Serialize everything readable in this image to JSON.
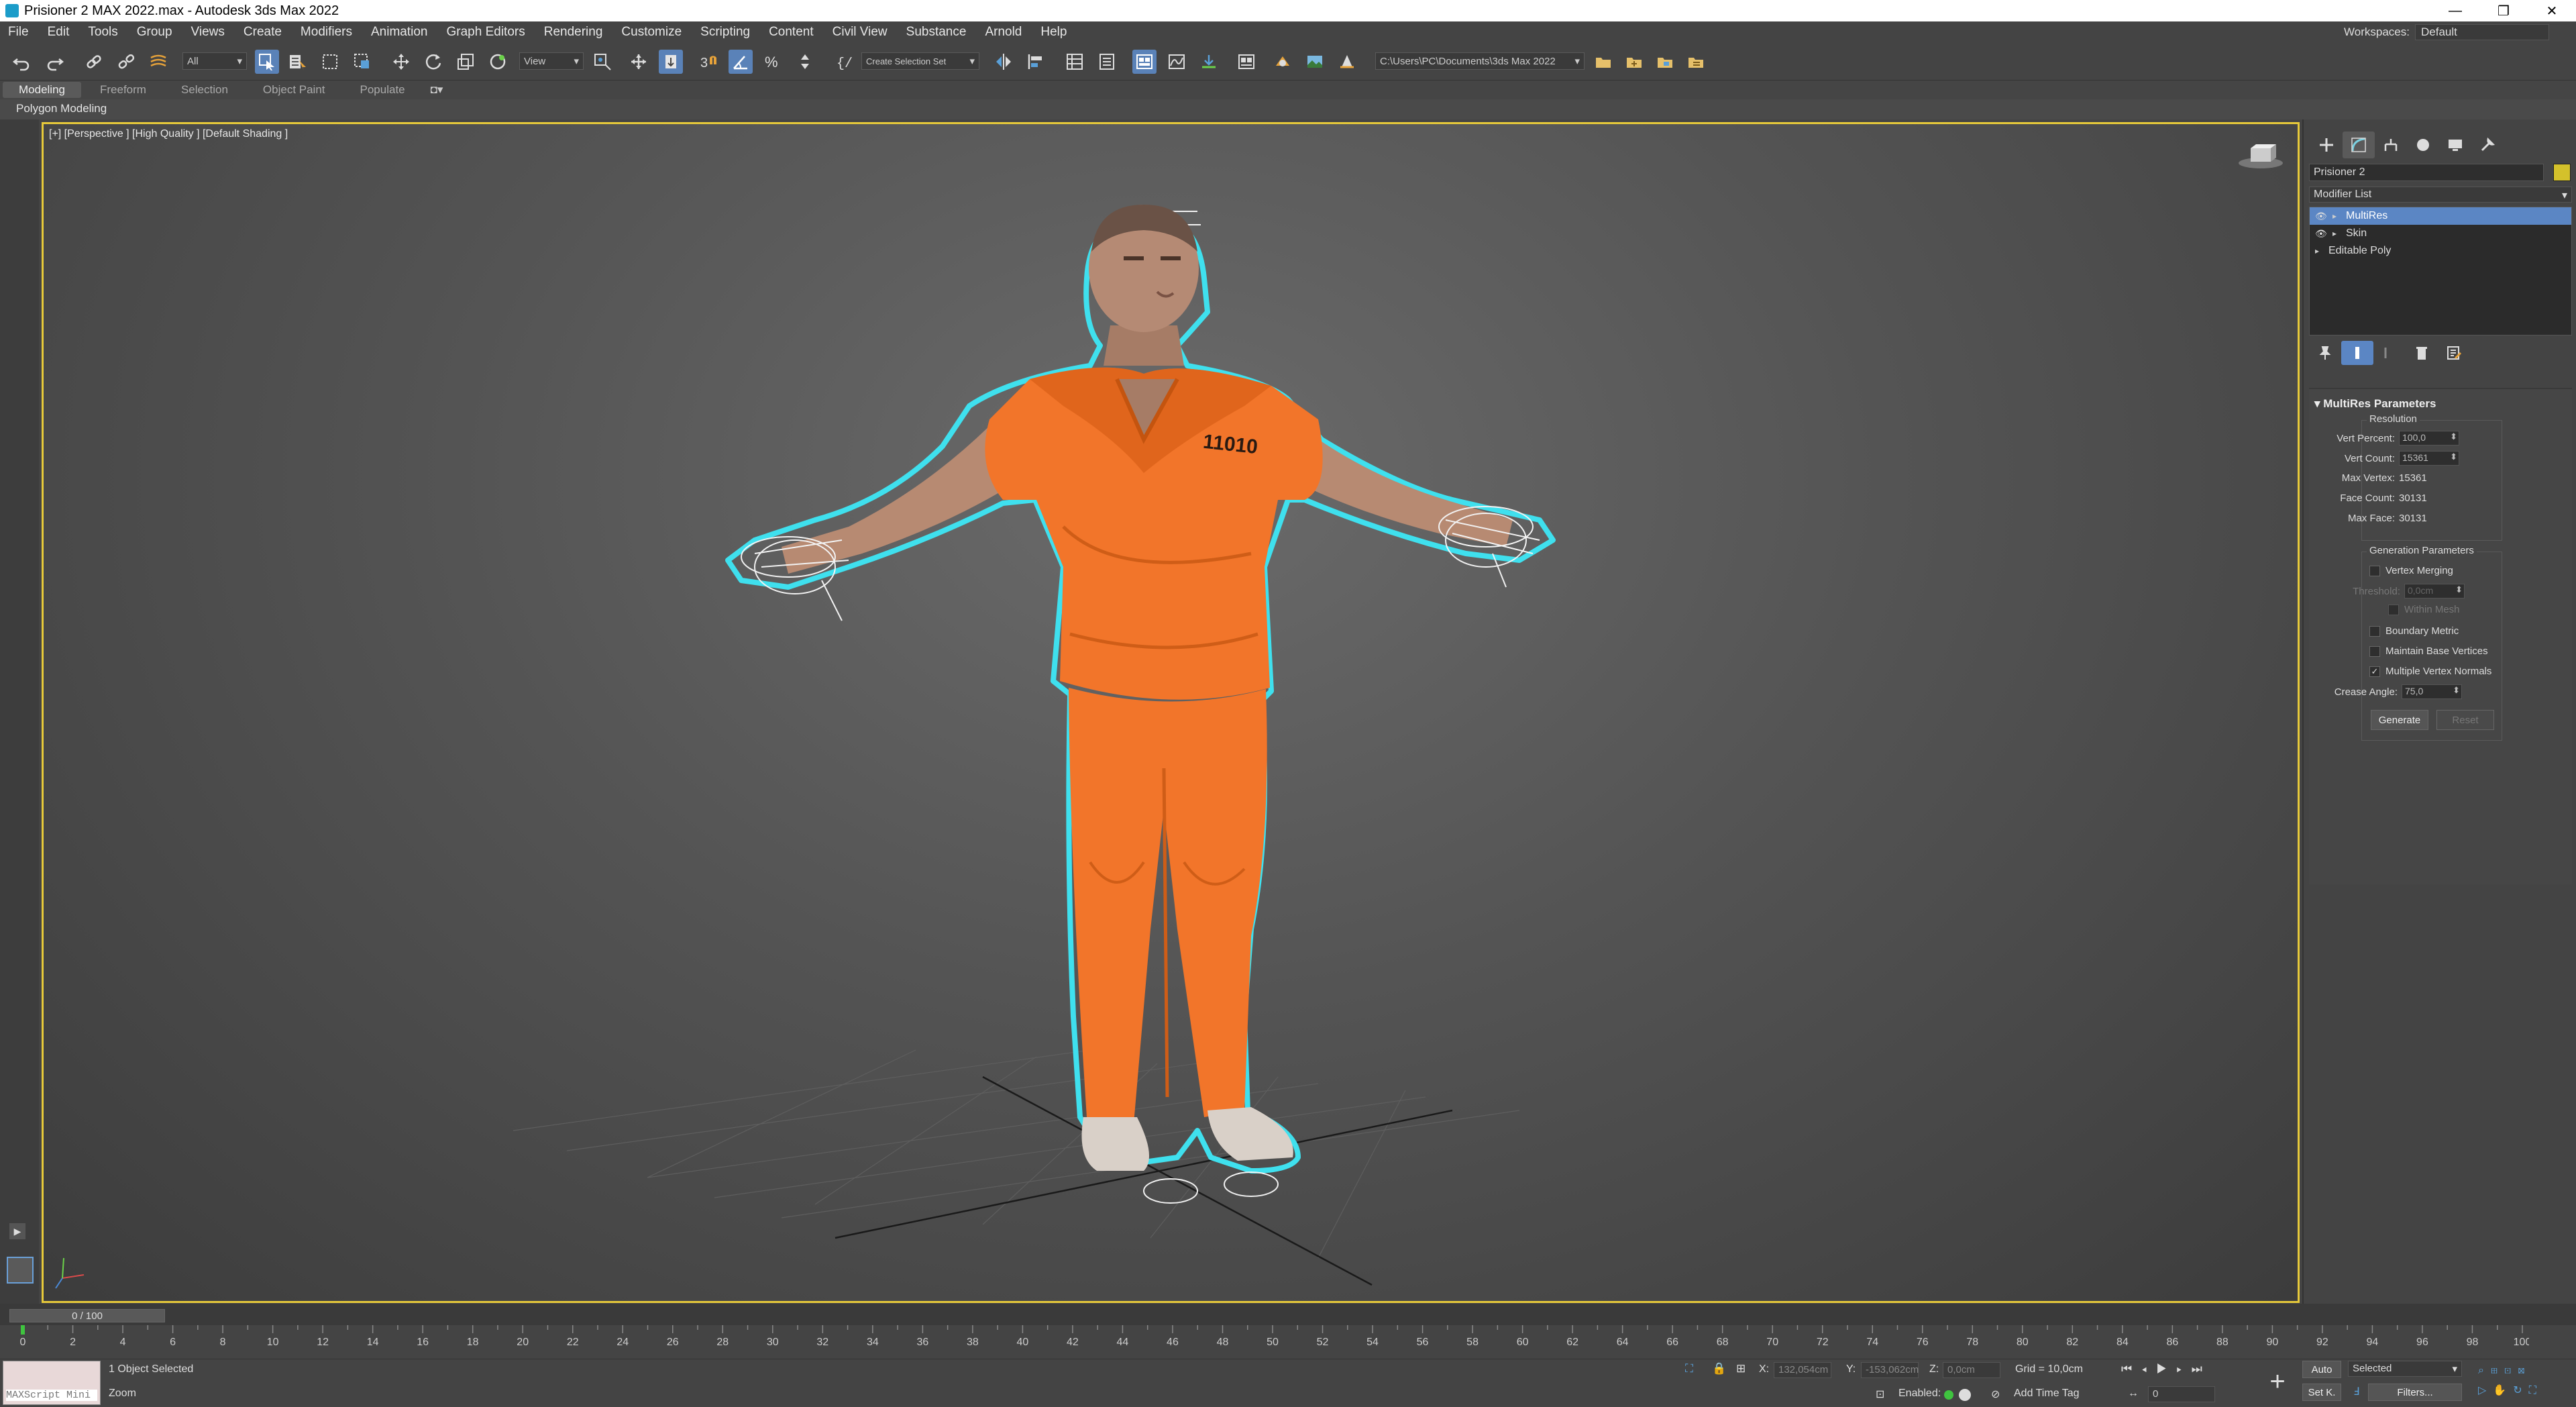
{
  "window": {
    "title": "Prisioner 2 MAX 2022.max - Autodesk 3ds Max 2022",
    "minimize": "—",
    "maximize": "❐",
    "close": "✕"
  },
  "menubar": {
    "items": [
      "File",
      "Edit",
      "Tools",
      "Group",
      "Views",
      "Create",
      "Modifiers",
      "Animation",
      "Graph Editors",
      "Rendering",
      "Customize",
      "Scripting",
      "Content",
      "Civil View",
      "Substance",
      "Arnold",
      "Help"
    ],
    "workspaces_label": "Workspaces:",
    "workspaces_value": "Default"
  },
  "toolbar": {
    "selection_filter": "All",
    "ref_coord": "View",
    "named_selection": "Create Selection Set",
    "project_path": "C:\\Users\\PC\\Documents\\3ds Max 2022"
  },
  "ribbon": {
    "tabs": [
      "Modeling",
      "Freeform",
      "Selection",
      "Object Paint",
      "Populate"
    ],
    "active_tab": "Modeling",
    "subtitle": "Polygon Modeling"
  },
  "viewport": {
    "label": "[+] [Perspective ] [High Quality ] [Default Shading ]",
    "shirt_number": "11010"
  },
  "command_panel": {
    "object_name": "Prisioner 2",
    "object_color": "#d4c12b",
    "modifier_list": "Modifier List",
    "stack": [
      {
        "label": "MultiRes",
        "selected": true,
        "eye": true
      },
      {
        "label": "Skin",
        "selected": false,
        "eye": true
      },
      {
        "label": "Editable Poly",
        "selected": false,
        "eye": false
      }
    ],
    "rollout_title": "MultiRes Parameters",
    "resolution": {
      "title": "Resolution",
      "vert_percent_label": "Vert Percent:",
      "vert_percent": "100,0",
      "vert_count_label": "Vert Count:",
      "vert_count": "15361",
      "max_vertex_label": "Max Vertex:",
      "max_vertex": "15361",
      "face_count_label": "Face Count:",
      "face_count": "30131",
      "max_face_label": "Max Face:",
      "max_face": "30131"
    },
    "generation": {
      "title": "Generation Parameters",
      "vertex_merging": "Vertex Merging",
      "threshold_label": "Threshold:",
      "threshold": "0,0cm",
      "within_mesh": "Within Mesh",
      "boundary_metric": "Boundary Metric",
      "maintain_base": "Maintain Base Vertices",
      "multiple_normals": "Multiple Vertex Normals",
      "crease_label": "Crease Angle:",
      "crease": "75,0",
      "generate": "Generate",
      "reset": "Reset"
    }
  },
  "timeline": {
    "slider": "0 / 100",
    "ticks": [
      "0",
      "2",
      "4",
      "6",
      "8",
      "10",
      "12",
      "14",
      "16",
      "18",
      "20",
      "22",
      "24",
      "26",
      "28",
      "30",
      "32",
      "34",
      "36",
      "38",
      "40",
      "42",
      "44",
      "46",
      "48",
      "50",
      "52",
      "54",
      "56",
      "58",
      "60",
      "62",
      "64",
      "66",
      "68",
      "70",
      "72",
      "74",
      "76",
      "78",
      "80",
      "82",
      "84",
      "86",
      "88",
      "90",
      "92",
      "94",
      "96",
      "98",
      "100"
    ]
  },
  "status": {
    "maxscript": "MAXScript Mini",
    "selected": "1 Object Selected",
    "prompt": "Zoom",
    "x_label": "X:",
    "x": "132,054cm",
    "y_label": "Y:",
    "y": "-153,062cm",
    "z_label": "Z:",
    "z": "0,0cm",
    "grid": "Grid = 10,0cm",
    "enabled": "Enabled:",
    "add_time_tag": "Add Time Tag",
    "auto": "Auto",
    "set_key": "Set K.",
    "key_filter": "Selected",
    "filters": "Filters...",
    "frame": "0"
  }
}
